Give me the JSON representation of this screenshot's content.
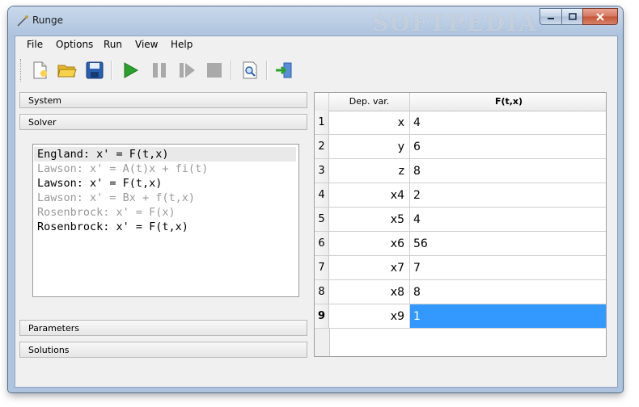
{
  "window": {
    "title": "Runge",
    "watermark": "SOFTPEDIA"
  },
  "menu": [
    "File",
    "Options",
    "Run",
    "View",
    "Help"
  ],
  "toolbar": [
    {
      "name": "new-file-icon"
    },
    {
      "name": "open-folder-icon"
    },
    {
      "name": "save-icon"
    },
    {
      "name": "play-icon",
      "color": "#2ca02c"
    },
    {
      "name": "pause-icon"
    },
    {
      "name": "step-icon"
    },
    {
      "name": "stop-icon"
    },
    {
      "name": "preview-icon"
    },
    {
      "name": "exit-icon"
    }
  ],
  "panels": {
    "system": "System",
    "solver": "Solver",
    "parameters": "Parameters",
    "solutions": "Solutions"
  },
  "solvers": [
    {
      "label": "England: x' = F(t,x)",
      "enabled": true,
      "selected": true
    },
    {
      "label": "Lawson: x' = A(t)x + fi(t)",
      "enabled": false,
      "selected": false
    },
    {
      "label": "Lawson: x' = F(t,x)",
      "enabled": true,
      "selected": false
    },
    {
      "label": "Lawson: x' = Bx + f(t,x)",
      "enabled": false,
      "selected": false
    },
    {
      "label": "Rosenbrock: x' = F(x)",
      "enabled": false,
      "selected": false
    },
    {
      "label": "Rosenbrock: x' = F(t,x)",
      "enabled": true,
      "selected": false
    }
  ],
  "table": {
    "headers": [
      "Dep. var.",
      "F(t,x)"
    ],
    "rows": [
      {
        "num": "1",
        "var": "x",
        "f": "4"
      },
      {
        "num": "2",
        "var": "y",
        "f": "6"
      },
      {
        "num": "3",
        "var": "z",
        "f": "8"
      },
      {
        "num": "4",
        "var": "x4",
        "f": "2"
      },
      {
        "num": "5",
        "var": "x5",
        "f": "4"
      },
      {
        "num": "6",
        "var": "x6",
        "f": "56"
      },
      {
        "num": "7",
        "var": "x7",
        "f": "7"
      },
      {
        "num": "8",
        "var": "x8",
        "f": "8"
      },
      {
        "num": "9",
        "var": "x9",
        "f": "1"
      }
    ],
    "selected_row": 8
  },
  "colors": {
    "selection": "#3399ff",
    "accent": "#2ca02c"
  }
}
